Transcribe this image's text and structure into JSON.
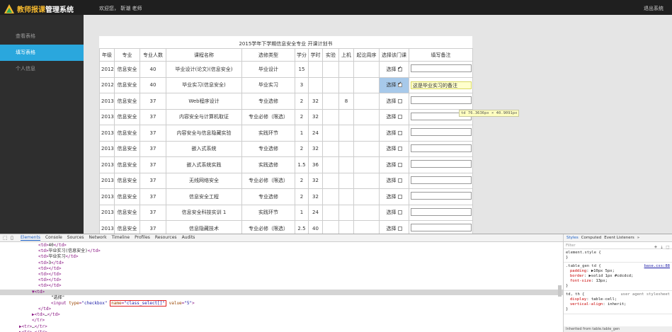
{
  "app": {
    "logo_highlight": "教师报课",
    "logo_rest": "管理系统",
    "welcome": "欢迎您，  靳潮 老师",
    "logout": "退出系统",
    "accent": "#2aa7dd",
    "logo_color": "#f5b82e"
  },
  "sidebar": {
    "items": [
      {
        "label": "查看表格"
      },
      {
        "label": "填写表格"
      },
      {
        "label": "个人信息"
      }
    ]
  },
  "sheet": {
    "title": "2015学年下学期信息安全专业  开课计划书",
    "headers": [
      "年级",
      "专业",
      "专业人数",
      "课程名称",
      "选修类型",
      "学分",
      "学时",
      "实验",
      "上机",
      "起讫周序",
      "选择该门课",
      "填写备注"
    ],
    "rows": [
      {
        "grade": "2012",
        "major": "信息安全",
        "count": "40",
        "course": "毕业设计(论文)(信息安全)",
        "type": "毕业设计",
        "credit": "15",
        "hours": "",
        "lab": "",
        "pc": "",
        "weeks": "",
        "select": "选择",
        "checked": true,
        "remark": "",
        "highlight": false
      },
      {
        "grade": "2012",
        "major": "信息安全",
        "count": "40",
        "course": "毕业实习(信息安全)",
        "type": "毕业实习",
        "credit": "3",
        "hours": "",
        "lab": "",
        "pc": "",
        "weeks": "",
        "select": "选择",
        "checked": true,
        "remark": "这是毕业实习的备注",
        "highlight": true
      },
      {
        "grade": "2013",
        "major": "信息安全",
        "count": "37",
        "course": "Web程序设计",
        "type": "专业选修",
        "credit": "2",
        "hours": "32",
        "lab": "",
        "pc": "8",
        "weeks": "",
        "select": "选择",
        "checked": false,
        "remark": "",
        "highlight": false
      },
      {
        "grade": "2013",
        "major": "信息安全",
        "count": "37",
        "course": "内容安全与计算机取证",
        "type": "专业必修（限选）",
        "credit": "2",
        "hours": "32",
        "lab": "",
        "pc": "",
        "weeks": "",
        "select": "选择",
        "checked": false,
        "remark": "",
        "highlight": false
      },
      {
        "grade": "2013",
        "major": "信息安全",
        "count": "37",
        "course": "内容安全与信息隐藏实验",
        "type": "实践环节",
        "credit": "1",
        "hours": "24",
        "lab": "",
        "pc": "",
        "weeks": "",
        "select": "选择",
        "checked": false,
        "remark": "",
        "highlight": false
      },
      {
        "grade": "2013",
        "major": "信息安全",
        "count": "37",
        "course": "嵌入式系统",
        "type": "专业选修",
        "credit": "2",
        "hours": "32",
        "lab": "",
        "pc": "",
        "weeks": "",
        "select": "选择",
        "checked": false,
        "remark": "",
        "highlight": false
      },
      {
        "grade": "2013",
        "major": "信息安全",
        "count": "37",
        "course": "嵌入式系统实践",
        "type": "实践选修",
        "credit": "1.5",
        "hours": "36",
        "lab": "",
        "pc": "",
        "weeks": "",
        "select": "选择",
        "checked": false,
        "remark": "",
        "highlight": false
      },
      {
        "grade": "2013",
        "major": "信息安全",
        "count": "37",
        "course": "无线网络安全",
        "type": "专业必修（限选）",
        "credit": "2",
        "hours": "32",
        "lab": "",
        "pc": "",
        "weeks": "",
        "select": "选择",
        "checked": false,
        "remark": "",
        "highlight": false
      },
      {
        "grade": "2013",
        "major": "信息安全",
        "count": "37",
        "course": "信息安全工程",
        "type": "专业选修",
        "credit": "2",
        "hours": "32",
        "lab": "",
        "pc": "",
        "weeks": "",
        "select": "选择",
        "checked": false,
        "remark": "",
        "highlight": false
      },
      {
        "grade": "2013",
        "major": "信息安全",
        "count": "37",
        "course": "信息安全科技实训 1",
        "type": "实践环节",
        "credit": "1",
        "hours": "24",
        "lab": "",
        "pc": "",
        "weeks": "",
        "select": "选择",
        "checked": false,
        "remark": "",
        "highlight": false
      },
      {
        "grade": "2013",
        "major": "信息安全",
        "count": "37",
        "course": "信息隐藏技术",
        "type": "专业必修（限选）",
        "credit": "2.5",
        "hours": "40",
        "lab": "",
        "pc": "",
        "weeks": "",
        "select": "选择",
        "checked": false,
        "remark": "",
        "highlight": false
      }
    ],
    "measure_tip": "td 76.3636px × 40.9091px"
  },
  "devtools": {
    "tabs": [
      "Elements",
      "Console",
      "Sources",
      "Network",
      "Timeline",
      "Profiles",
      "Resources",
      "Audits"
    ],
    "dom_lines": [
      {
        "indent": 6,
        "html": "<td>40</td>"
      },
      {
        "indent": 6,
        "html": "<td>毕业实习(信息安全)</td>"
      },
      {
        "indent": 6,
        "html": "<td>毕业实习</td>"
      },
      {
        "indent": 6,
        "html": "<td>3</td>"
      },
      {
        "indent": 6,
        "html": "<td></td>"
      },
      {
        "indent": 6,
        "html": "<td></td>"
      },
      {
        "indent": 6,
        "html": "<td></td>"
      },
      {
        "indent": 6,
        "html": "<td></td>"
      },
      {
        "indent": 5,
        "html": "▼<td>"
      },
      {
        "indent": 8,
        "html": "\"选择\""
      },
      {
        "indent": 8,
        "html": "<input type=\"checkbox\" name=\"class_select[]\" value=\"5\">"
      },
      {
        "indent": 6,
        "html": "</td>"
      },
      {
        "indent": 5,
        "html": "▶<td>…</td>"
      },
      {
        "indent": 5,
        "html": "</tr>"
      },
      {
        "indent": 3,
        "html": "▶<tr>…</tr>"
      },
      {
        "indent": 3,
        "html": "▶<tr>…</tr>"
      },
      {
        "indent": 3,
        "html": "▶<tr>…</tr>"
      }
    ],
    "styles_tabs": [
      "Styles",
      "Computed",
      "Event Listeners",
      "»"
    ],
    "filter_placeholder": "Filter",
    "element_style": "element.style {",
    "rule1_selector": ".table_gen td {",
    "rule1_source": "base.css:88",
    "rule1_props": [
      {
        "name": "padding",
        "value": "▶10px 5px;"
      },
      {
        "name": "border",
        "value": "▶solid 1px #cdcdcd;"
      },
      {
        "name": "font-size",
        "value": "13px;"
      }
    ],
    "rule2_selector": "td, th {",
    "rule2_source": "user agent stylesheet",
    "rule2_props": [
      {
        "name": "display",
        "value": "table-cell;"
      },
      {
        "name": "vertical-align",
        "value": "inherit;"
      }
    ],
    "inherited": "Inherited from table.table_gen"
  }
}
